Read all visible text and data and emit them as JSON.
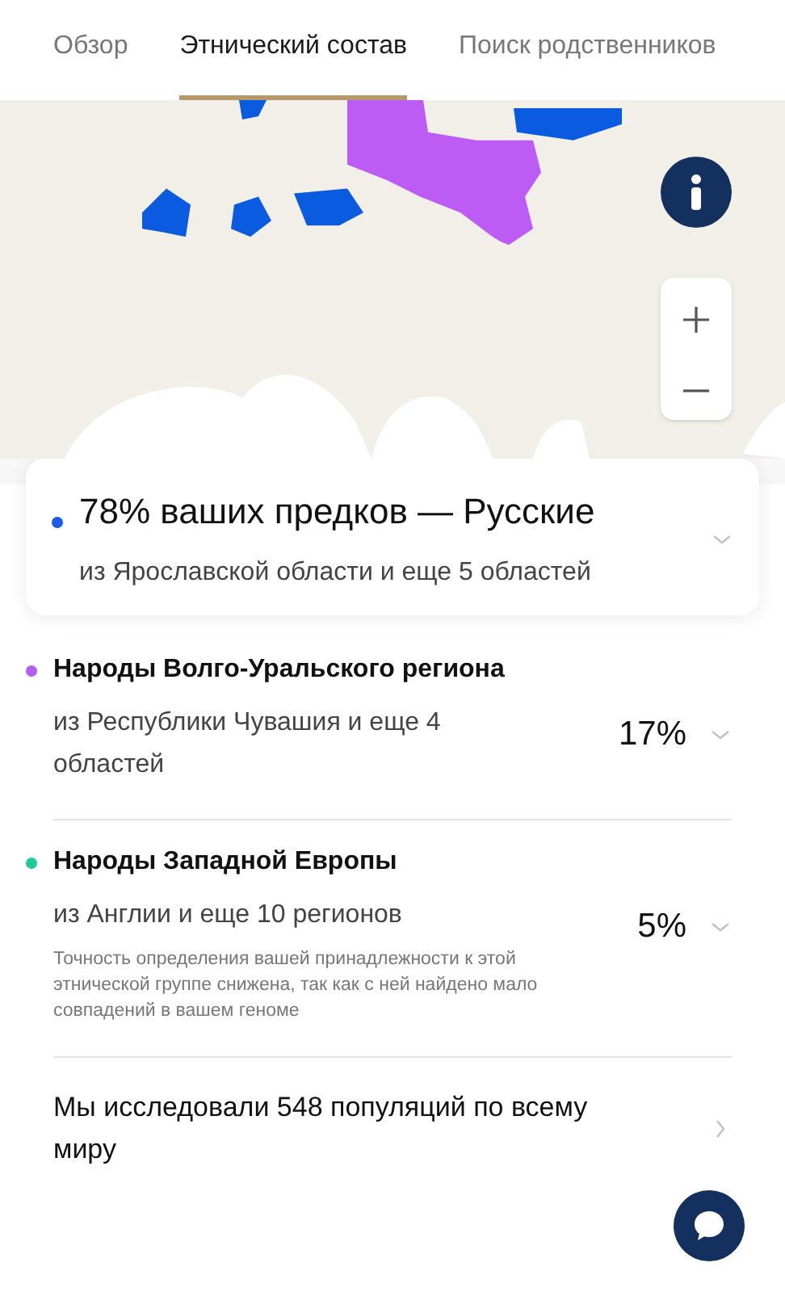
{
  "tabs": [
    {
      "label": "Обзор",
      "selected": false
    },
    {
      "label": "Этнический состав",
      "selected": true
    },
    {
      "label": "Поиск родственников",
      "selected": false
    }
  ],
  "ethnicities": [
    {
      "kind": "featured",
      "color": "#1a5ce6",
      "title": "78% ваших предков — Русские",
      "subtitle": "из Ярославской области и еще 5 областей"
    },
    {
      "kind": "row",
      "color": "#b35ef0",
      "title": "Народы Волго-Уральского региона",
      "subtitle": "из Республики Чувашия и еще 4 областей",
      "percent": "17%"
    },
    {
      "kind": "row",
      "color": "#1ec99a",
      "title": "Народы Западной Европы",
      "subtitle": "из Англии и еще 10 регионов",
      "percent": "5%",
      "note": "Точность определения вашей принадлежности к этой этнической группе снижена, так как с ней найдено мало совпадений в вашем геноме"
    }
  ],
  "populations_link": "Мы исследовали 548 популяций по всему миру"
}
